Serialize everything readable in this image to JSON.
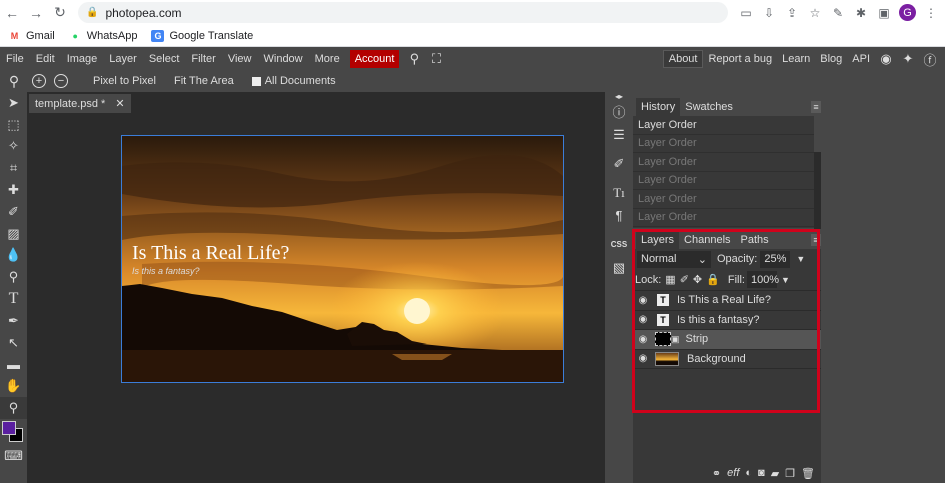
{
  "browser": {
    "url": "photopea.com",
    "profile_initial": "G",
    "bookmarks": [
      {
        "label": "Gmail",
        "icon": "gmail-icon",
        "color": "#ea4335",
        "glyph": "M"
      },
      {
        "label": "WhatsApp",
        "icon": "whatsapp-icon",
        "color": "#25d366",
        "glyph": "●"
      },
      {
        "label": "Google Translate",
        "icon": "translate-icon",
        "color": "#4285f4",
        "glyph": "G"
      }
    ]
  },
  "menu": {
    "items": [
      "File",
      "Edit",
      "Image",
      "Layer",
      "Select",
      "Filter",
      "View",
      "Window",
      "More"
    ],
    "account": "Account",
    "right": [
      "About",
      "Report a bug",
      "Learn",
      "Blog",
      "API"
    ]
  },
  "options": {
    "pixel_to_pixel": "Pixel to Pixel",
    "fit_area": "Fit The Area",
    "all_documents": "All Documents"
  },
  "document": {
    "tab_label": "template.psd *",
    "title_text": "Is This a Real Life?",
    "subtitle_text": "Is this a fantasy?"
  },
  "history": {
    "tabs": [
      "History",
      "Swatches"
    ],
    "items": [
      "Layer Order",
      "Layer Order",
      "Layer Order",
      "Layer Order",
      "Layer Order",
      "Layer Order"
    ]
  },
  "layers": {
    "tabs": [
      "Layers",
      "Channels",
      "Paths"
    ],
    "blend_mode": "Normal",
    "opacity_label": "Opacity:",
    "opacity_value": "25%",
    "lock_label": "Lock:",
    "fill_label": "Fill:",
    "fill_value": "100%",
    "items": [
      {
        "name": "Is This a Real Life?",
        "type": "text"
      },
      {
        "name": "Is this a fantasy?",
        "type": "text"
      },
      {
        "name": "Strip",
        "type": "mask",
        "selected": true
      },
      {
        "name": "Background",
        "type": "image"
      }
    ],
    "footer_label": "eff"
  },
  "colors": {
    "foreground": "#5a1fa0",
    "background": "#000000",
    "highlight": "#d0021b",
    "account": "#b30000"
  },
  "side_panel": {
    "css_label": "CSS"
  }
}
